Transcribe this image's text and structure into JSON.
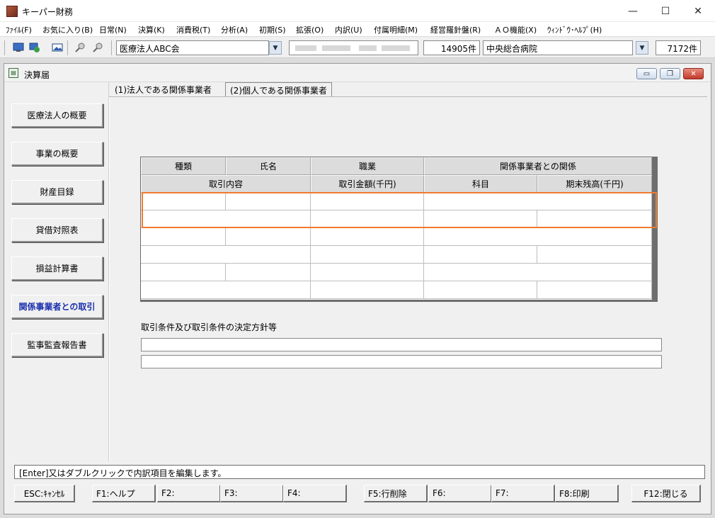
{
  "app": {
    "title": "キーパー財務"
  },
  "window_controls": {
    "minimize": "—",
    "maximize": "☐",
    "close": "✕"
  },
  "menu": [
    "ﾌｧｲﾙ(F)",
    "お気に入り(B)",
    "日常(N)",
    "決算(K)",
    "消費税(T)",
    "分析(A)",
    "初期(S)",
    "拡張(O)",
    "内訳(U)",
    "付属明細(M)",
    "経営羅針盤(R)",
    "ＡＯ機能(X)",
    "ｳｨﾝﾄﾞｳ･ﾍﾙﾌﾟ(H)"
  ],
  "toolbar": {
    "icons": [
      "monitor-icon",
      "refresh-icon",
      "image-icon",
      "search-icon",
      "search-alt-icon"
    ],
    "company_name": "医療法人ABC会",
    "company_count": "14905件",
    "office_name": "中央総合病院",
    "office_count": "7172件"
  },
  "child": {
    "title": "決算届",
    "controls": {
      "minimize": "▭",
      "restore": "❐",
      "close": "✕"
    }
  },
  "sidebar": {
    "items": [
      {
        "label": "医療法人の概要",
        "active": false
      },
      {
        "label": "事業の概要",
        "active": false
      },
      {
        "label": "財産目録",
        "active": false
      },
      {
        "label": "貸借対照表",
        "active": false
      },
      {
        "label": "損益計算書",
        "active": false
      },
      {
        "label": "関係事業者との取引",
        "active": true
      },
      {
        "label": "監事監査報告書",
        "active": false
      }
    ]
  },
  "tabs": [
    {
      "label": "(1)法人である関係事業者",
      "selected": false
    },
    {
      "label": "(2)個人である関係事業者",
      "selected": true
    }
  ],
  "grid": {
    "header_row1": [
      "種類",
      "氏名",
      "職業",
      "関係事業者との関係"
    ],
    "header_row2": [
      "取引内容",
      "取引金額(千円)",
      "科目",
      "期末残高(千円)"
    ],
    "records": [
      {
        "kind": "",
        "name": "",
        "occupation": "",
        "relation": "",
        "content": "",
        "amount": "",
        "account": "",
        "balance": ""
      },
      {
        "kind": "",
        "name": "",
        "occupation": "",
        "relation": "",
        "content": "",
        "amount": "",
        "account": "",
        "balance": ""
      },
      {
        "kind": "",
        "name": "",
        "occupation": "",
        "relation": "",
        "content": "",
        "amount": "",
        "account": "",
        "balance": ""
      }
    ]
  },
  "conditions": {
    "label": "取引条件及び取引条件の決定方針等",
    "line1": "",
    "line2": ""
  },
  "status_text": "[Enter]又はダブルクリックで内訳項目を編集します。",
  "fkeys": [
    "ESC:ｷｬﾝｾﾙ",
    "F1:ヘルプ",
    "F2:",
    "F3:",
    "F4:",
    "F5:行削除",
    "F6:",
    "F7:",
    "F8:印刷",
    "F12:閉じる"
  ]
}
